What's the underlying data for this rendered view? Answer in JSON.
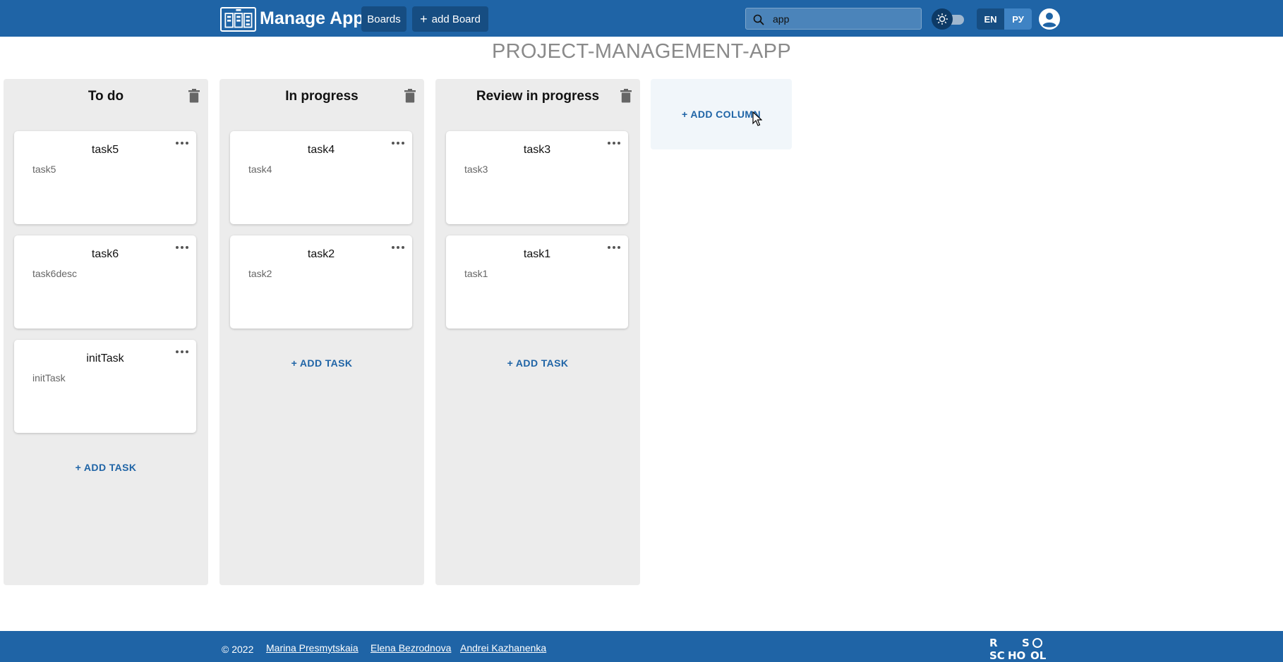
{
  "header": {
    "app_title": "Manage App",
    "boards_label": "Boards",
    "add_board_label": "add Board",
    "search": {
      "value": "app"
    },
    "lang": {
      "en": "EN",
      "ru": "РУ"
    },
    "icons": {
      "logo": "board-logo-icon",
      "search": "search-icon",
      "theme": "sun-icon",
      "user": "account-circle-icon"
    }
  },
  "page_title": "PROJECT-MANAGEMENT-APP",
  "columns": [
    {
      "title": "To do",
      "tasks": [
        {
          "title": "task5",
          "description": "task5"
        },
        {
          "title": "task6",
          "description": "task6desc"
        },
        {
          "title": "initTask",
          "description": "initTask"
        }
      ],
      "add_task_label": "+ ADD TASK"
    },
    {
      "title": "In progress",
      "tasks": [
        {
          "title": "task4",
          "description": "task4"
        },
        {
          "title": "task2",
          "description": "task2"
        }
      ],
      "add_task_label": "+ ADD TASK"
    },
    {
      "title": "Review in progress",
      "tasks": [
        {
          "title": "task3",
          "description": "task3"
        },
        {
          "title": "task1",
          "description": "task1"
        }
      ],
      "add_task_label": "+ ADD TASK"
    }
  ],
  "add_column_label": "+ ADD COLUMN",
  "footer": {
    "copyright": "© 2022",
    "authors": [
      "Marina Presmytskaia",
      "Elena Bezrodnova",
      "Andrei Kazhanenka"
    ]
  },
  "colors": {
    "primary": "#1f64a6",
    "column_bg": "#ececec",
    "title_gray": "#8a8a8a"
  }
}
